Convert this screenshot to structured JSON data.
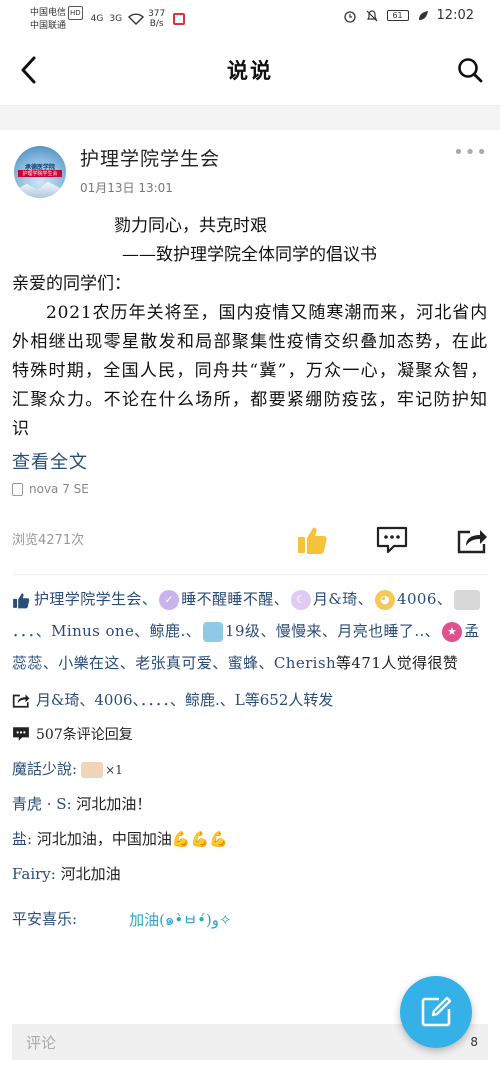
{
  "status_bar": {
    "carrier1": "中国电信",
    "carrier1_badge": "HD",
    "carrier2": "中国联通",
    "signal1": "4G",
    "signal2": "3G",
    "net_speed": "377",
    "net_unit": "B/s",
    "battery": "61",
    "time": "12:02"
  },
  "navbar": {
    "title": "说说"
  },
  "post": {
    "author": "护理学院学生会",
    "avatar_line1": "承德医学院",
    "avatar_line2": "护理学院学生会",
    "time": "01月13日 13:01",
    "title_line1": "勠力同心，共克时艰",
    "title_line2": "——致护理学院全体同学的倡议书",
    "greeting": "亲爱的同学们：",
    "paragraph": "2021农历年关将至，国内疫情又随寒潮而来，河北省内外相继出现零星散发和局部聚集性疫情交织叠加态势，在此特殊时期，全国人民，同舟共“冀”，万众一心，凝聚众智，汇聚众力。不论在什么场所，都要紧绷防疫弦，牢记防护知识",
    "read_full": "查看全文",
    "device": "nova 7 SE",
    "views": "浏览4271次"
  },
  "likes": {
    "n1": "护理学院学生会",
    "n2": "睡不醒睡不醒",
    "n3": "月&琦",
    "n4": "4006",
    "n5": "．．．",
    "n6": "Minus one",
    "n7": "鲸鹿.",
    "n8": "19级",
    "n9": "慢慢来",
    "n10": "月亮也睡了..",
    "n11": "孟蕊蕊",
    "n12": "小樂在这",
    "n13": "老张真可爱",
    "n14": "蜜蜂",
    "n15": "Cherish",
    "suffix": "等471人觉得很赞"
  },
  "shares": {
    "text": "月&琦、4006、．．．．、鲸鹿.、L等652人转发"
  },
  "comments": {
    "count": "507条评论回复",
    "items": [
      {
        "name": "魔話少說:",
        "text": "",
        "extra": "×1"
      },
      {
        "name": "青虎 · S:",
        "text": " 河北加油！"
      },
      {
        "name": "盐:",
        "text": " 河北加油，中国加油",
        "emoji": "💪💪💪"
      },
      {
        "name": "Fairy:",
        "text": " 河北加油"
      },
      {
        "name": "平安喜乐:",
        "text": "加油(๑•̀ㅂ•́)و✧"
      }
    ]
  },
  "comment_bar": {
    "placeholder": "评论",
    "right_count": "8"
  }
}
